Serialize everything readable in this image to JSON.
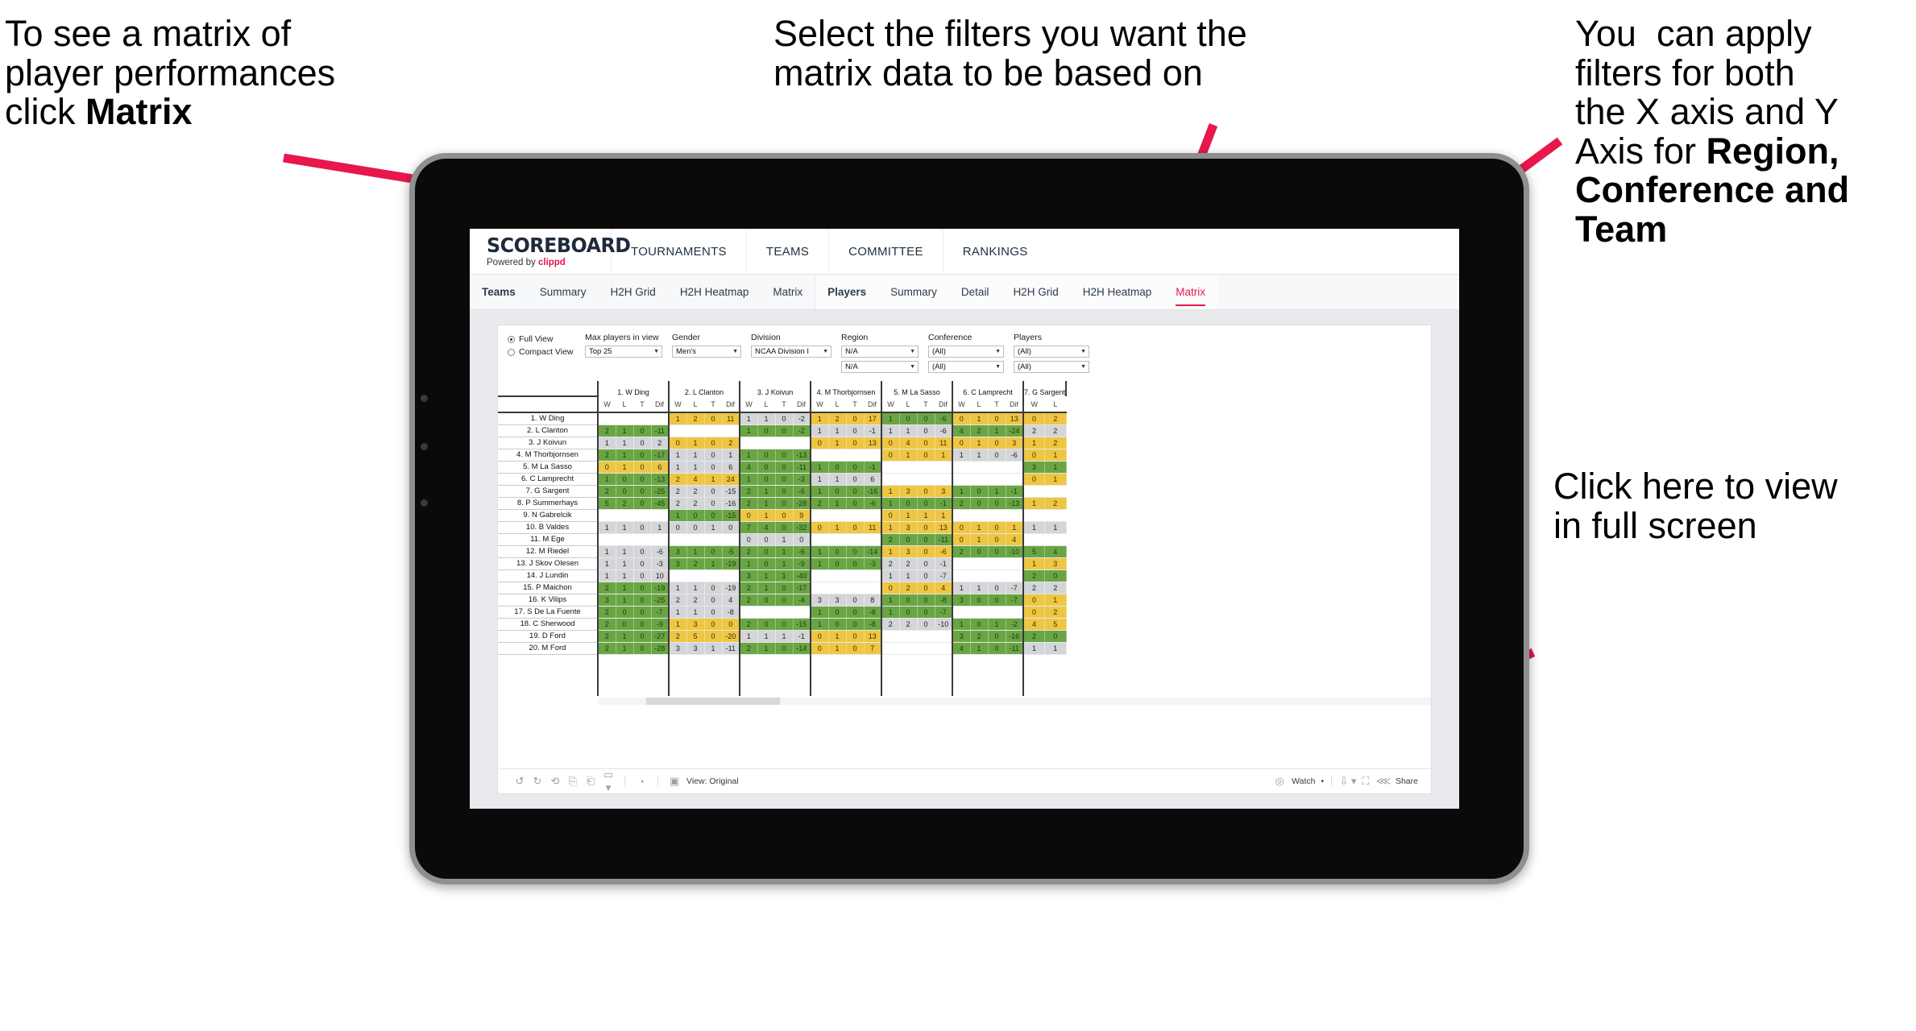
{
  "annotations": {
    "matrix_tip": {
      "pre": "To see a matrix of\nplayer performances\nclick ",
      "strong": "Matrix"
    },
    "filters_tip": {
      "text": "Select the filters you want the\nmatrix data to be based on"
    },
    "axis_tip": {
      "pre": "You  can apply\nfilters for both\nthe X axis and Y\nAxis for ",
      "strong": "Region,\nConference and\nTeam"
    },
    "fullscreen_tip": {
      "text": "Click here to view\nin full screen"
    }
  },
  "brand": {
    "logo": "SCOREBOARD",
    "powered_prefix": "Powered by ",
    "powered_brand": "clippd",
    "accent_color": "#e8174c"
  },
  "topnav": [
    "TOURNAMENTS",
    "TEAMS",
    "COMMITTEE",
    "RANKINGS"
  ],
  "subnav": {
    "teams_group_label": "Teams",
    "teams_items": [
      "Summary",
      "H2H Grid",
      "H2H Heatmap",
      "Matrix"
    ],
    "players_group_label": "Players",
    "players_items": [
      "Summary",
      "Detail",
      "H2H Grid",
      "H2H Heatmap",
      "Matrix"
    ],
    "active": "Matrix"
  },
  "filters": {
    "view_options": [
      "Full View",
      "Compact View"
    ],
    "view_selected": "Full View",
    "controls": [
      {
        "label": "Max players in view",
        "value": "Top 25",
        "row2": null
      },
      {
        "label": "Gender",
        "value": "Men's",
        "row2": null
      },
      {
        "label": "Division",
        "value": "NCAA Division I",
        "row2": null
      },
      {
        "label": "Region",
        "value": "N/A",
        "row2": "N/A"
      },
      {
        "label": "Conference",
        "value": "(All)",
        "row2": "(All)"
      },
      {
        "label": "Players",
        "value": "(All)",
        "row2": "(All)"
      }
    ]
  },
  "chart_data": {
    "type": "heatmap",
    "title": "Player head-to-head performance matrix",
    "stat_headers": [
      "W",
      "L",
      "T",
      "Dif"
    ],
    "columns": [
      "1. W Ding",
      "2. L Clanton",
      "3. J Koivun",
      "4. M Thorbjornsen",
      "5. M La Sasso",
      "6. C Lamprecht",
      "7. G Sargent"
    ],
    "rows": [
      "1. W Ding",
      "2. L Clanton",
      "3. J Koivun",
      "4. M Thorbjornsen",
      "5. M La Sasso",
      "6. C Lamprecht",
      "7. G Sargent",
      "8. P Summerhays",
      "9. N Gabrelcik",
      "10. B Valdes",
      "11. M Ege",
      "12. M Riedel",
      "13. J Skov Olesen",
      "14. J Lundin",
      "15. P Maichon",
      "16. K Vilips",
      "17. S De La Fuente",
      "18. C Sherwood",
      "19. D Ford",
      "20. M Ford"
    ],
    "color_legend": {
      "green": "#6aa544",
      "gray": "#d3d5d8",
      "gold": "#eec643",
      "blank": "#ffffff"
    },
    "cells": [
      [
        {
          "b": 1
        },
        {
          "v": [
            1,
            2,
            0,
            11
          ],
          "c": "gold"
        },
        {
          "v": [
            1,
            1,
            0,
            -2
          ],
          "c": "gray"
        },
        {
          "v": [
            1,
            2,
            0,
            17
          ],
          "c": "gold"
        },
        {
          "v": [
            1,
            0,
            0,
            -6
          ],
          "c": "green"
        },
        {
          "v": [
            0,
            1,
            0,
            13
          ],
          "c": "gold"
        },
        {
          "v": [
            0,
            2
          ],
          "c": "gold"
        }
      ],
      [
        {
          "v": [
            2,
            1,
            0,
            -11
          ],
          "c": "green"
        },
        {
          "b": 1
        },
        {
          "v": [
            1,
            0,
            0,
            -2
          ],
          "c": "green"
        },
        {
          "v": [
            1,
            1,
            0,
            -1
          ],
          "c": "gray"
        },
        {
          "v": [
            1,
            1,
            0,
            -6
          ],
          "c": "gray"
        },
        {
          "v": [
            4,
            2,
            1,
            -24
          ],
          "c": "green"
        },
        {
          "v": [
            2,
            2
          ],
          "c": "gray"
        }
      ],
      [
        {
          "v": [
            1,
            1,
            0,
            2
          ],
          "c": "gray"
        },
        {
          "v": [
            0,
            1,
            0,
            2
          ],
          "c": "gold"
        },
        {
          "b": 1
        },
        {
          "v": [
            0,
            1,
            0,
            13
          ],
          "c": "gold"
        },
        {
          "v": [
            0,
            4,
            0,
            11
          ],
          "c": "gold"
        },
        {
          "v": [
            0,
            1,
            0,
            3
          ],
          "c": "gold"
        },
        {
          "v": [
            1,
            2
          ],
          "c": "gold"
        }
      ],
      [
        {
          "v": [
            2,
            1,
            0,
            -17
          ],
          "c": "green"
        },
        {
          "v": [
            1,
            1,
            0,
            1
          ],
          "c": "gray"
        },
        {
          "v": [
            1,
            0,
            0,
            -13
          ],
          "c": "green"
        },
        {
          "b": 1
        },
        {
          "v": [
            0,
            1,
            0,
            1
          ],
          "c": "gold"
        },
        {
          "v": [
            1,
            1,
            0,
            -6
          ],
          "c": "gray"
        },
        {
          "v": [
            0,
            1
          ],
          "c": "gold"
        }
      ],
      [
        {
          "v": [
            0,
            1,
            0,
            6
          ],
          "c": "gold"
        },
        {
          "v": [
            1,
            1,
            0,
            6
          ],
          "c": "gray"
        },
        {
          "v": [
            4,
            0,
            0,
            -11
          ],
          "c": "green"
        },
        {
          "v": [
            1,
            0,
            0,
            -1
          ],
          "c": "green"
        },
        {
          "b": 1
        },
        {
          "b": 1
        },
        {
          "v": [
            3,
            1
          ],
          "c": "green"
        }
      ],
      [
        {
          "v": [
            1,
            0,
            0,
            -13
          ],
          "c": "green"
        },
        {
          "v": [
            2,
            4,
            1,
            24
          ],
          "c": "gold"
        },
        {
          "v": [
            1,
            0,
            0,
            -3
          ],
          "c": "green"
        },
        {
          "v": [
            1,
            1,
            0,
            6
          ],
          "c": "gray"
        },
        {
          "b": 1
        },
        {
          "b": 1
        },
        {
          "v": [
            0,
            1
          ],
          "c": "gold"
        }
      ],
      [
        {
          "v": [
            2,
            0,
            0,
            -25
          ],
          "c": "green"
        },
        {
          "v": [
            2,
            2,
            0,
            -15
          ],
          "c": "gray"
        },
        {
          "v": [
            2,
            1,
            0,
            -6
          ],
          "c": "green"
        },
        {
          "v": [
            1,
            0,
            0,
            -16
          ],
          "c": "green"
        },
        {
          "v": [
            1,
            3,
            0,
            3
          ],
          "c": "gold"
        },
        {
          "v": [
            1,
            0,
            1,
            -1
          ],
          "c": "green"
        },
        {
          "b": 1
        }
      ],
      [
        {
          "v": [
            5,
            2,
            0,
            -45
          ],
          "c": "green"
        },
        {
          "v": [
            2,
            2,
            0,
            -16
          ],
          "c": "gray"
        },
        {
          "v": [
            2,
            1,
            0,
            -28
          ],
          "c": "green"
        },
        {
          "v": [
            2,
            1,
            0,
            -6
          ],
          "c": "green"
        },
        {
          "v": [
            1,
            0,
            0,
            -1
          ],
          "c": "green"
        },
        {
          "v": [
            2,
            0,
            0,
            -13
          ],
          "c": "green"
        },
        {
          "v": [
            1,
            2
          ],
          "c": "gold"
        }
      ],
      [
        {
          "b": 1
        },
        {
          "v": [
            1,
            0,
            0,
            -15
          ],
          "c": "green"
        },
        {
          "v": [
            0,
            1,
            0,
            9
          ],
          "c": "gold"
        },
        {
          "b": 1
        },
        {
          "v": [
            0,
            1,
            1,
            1
          ],
          "c": "gold"
        },
        {
          "b": 1
        },
        {
          "b": 1
        }
      ],
      [
        {
          "v": [
            1,
            1,
            0,
            1
          ],
          "c": "gray"
        },
        {
          "v": [
            0,
            0,
            1,
            0
          ],
          "c": "gray"
        },
        {
          "v": [
            7,
            4,
            0,
            -32
          ],
          "c": "green"
        },
        {
          "v": [
            0,
            1,
            0,
            11
          ],
          "c": "gold"
        },
        {
          "v": [
            1,
            3,
            0,
            13
          ],
          "c": "gold"
        },
        {
          "v": [
            0,
            1,
            0,
            1
          ],
          "c": "gold"
        },
        {
          "v": [
            1,
            1
          ],
          "c": "gray"
        }
      ],
      [
        {
          "b": 1
        },
        {
          "b": 1
        },
        {
          "v": [
            0,
            0,
            1,
            0
          ],
          "c": "gray"
        },
        {
          "b": 1
        },
        {
          "v": [
            2,
            0,
            0,
            -11
          ],
          "c": "green"
        },
        {
          "v": [
            0,
            1,
            0,
            4
          ],
          "c": "gold"
        },
        {
          "b": 1
        }
      ],
      [
        {
          "v": [
            1,
            1,
            0,
            -6
          ],
          "c": "gray"
        },
        {
          "v": [
            3,
            1,
            0,
            -5
          ],
          "c": "green"
        },
        {
          "v": [
            2,
            0,
            1,
            -6
          ],
          "c": "green"
        },
        {
          "v": [
            1,
            0,
            0,
            -14
          ],
          "c": "green"
        },
        {
          "v": [
            1,
            3,
            0,
            -6
          ],
          "c": "gold"
        },
        {
          "v": [
            2,
            0,
            0,
            -10
          ],
          "c": "green"
        },
        {
          "v": [
            5,
            4
          ],
          "c": "green"
        }
      ],
      [
        {
          "v": [
            1,
            1,
            0,
            -3
          ],
          "c": "gray"
        },
        {
          "v": [
            3,
            2,
            1,
            -19
          ],
          "c": "green"
        },
        {
          "v": [
            1,
            0,
            1,
            -9
          ],
          "c": "green"
        },
        {
          "v": [
            1,
            0,
            0,
            -3
          ],
          "c": "green"
        },
        {
          "v": [
            2,
            2,
            0,
            -1
          ],
          "c": "gray"
        },
        {
          "b": 1
        },
        {
          "v": [
            1,
            3
          ],
          "c": "gold"
        }
      ],
      [
        {
          "v": [
            1,
            1,
            0,
            10
          ],
          "c": "gray"
        },
        {
          "b": 1
        },
        {
          "v": [
            3,
            1,
            1,
            -40
          ],
          "c": "green"
        },
        {
          "b": 1
        },
        {
          "v": [
            1,
            1,
            0,
            -7
          ],
          "c": "gray"
        },
        {
          "b": 1
        },
        {
          "v": [
            2,
            0
          ],
          "c": "green"
        }
      ],
      [
        {
          "v": [
            2,
            1,
            0,
            -19
          ],
          "c": "green"
        },
        {
          "v": [
            1,
            1,
            0,
            -19
          ],
          "c": "gray"
        },
        {
          "v": [
            2,
            1,
            0,
            -17
          ],
          "c": "green"
        },
        {
          "b": 1
        },
        {
          "v": [
            0,
            2,
            0,
            4
          ],
          "c": "gold"
        },
        {
          "v": [
            1,
            1,
            0,
            -7
          ],
          "c": "gray"
        },
        {
          "v": [
            2,
            2
          ],
          "c": "gray"
        }
      ],
      [
        {
          "v": [
            3,
            1,
            0,
            -25
          ],
          "c": "green"
        },
        {
          "v": [
            2,
            2,
            0,
            4
          ],
          "c": "gray"
        },
        {
          "v": [
            2,
            0,
            0,
            -4
          ],
          "c": "green"
        },
        {
          "v": [
            3,
            3,
            0,
            8
          ],
          "c": "gray"
        },
        {
          "v": [
            1,
            0,
            0,
            -8
          ],
          "c": "green"
        },
        {
          "v": [
            3,
            0,
            0,
            -7
          ],
          "c": "green"
        },
        {
          "v": [
            0,
            1
          ],
          "c": "gold"
        }
      ],
      [
        {
          "v": [
            2,
            0,
            0,
            -7
          ],
          "c": "green"
        },
        {
          "v": [
            1,
            1,
            0,
            -8
          ],
          "c": "gray"
        },
        {
          "b": 1
        },
        {
          "v": [
            1,
            0,
            0,
            -8
          ],
          "c": "green"
        },
        {
          "v": [
            1,
            0,
            0,
            -7
          ],
          "c": "green"
        },
        {
          "b": 1
        },
        {
          "v": [
            0,
            2
          ],
          "c": "gold"
        }
      ],
      [
        {
          "v": [
            2,
            0,
            0,
            -9
          ],
          "c": "green"
        },
        {
          "v": [
            1,
            3,
            0,
            0
          ],
          "c": "gold"
        },
        {
          "v": [
            2,
            0,
            0,
            -15
          ],
          "c": "green"
        },
        {
          "v": [
            1,
            0,
            0,
            -8
          ],
          "c": "green"
        },
        {
          "v": [
            2,
            2,
            0,
            -10
          ],
          "c": "gray"
        },
        {
          "v": [
            1,
            0,
            1,
            -2
          ],
          "c": "green"
        },
        {
          "v": [
            4,
            5
          ],
          "c": "gold"
        }
      ],
      [
        {
          "v": [
            2,
            1,
            0,
            -27
          ],
          "c": "green"
        },
        {
          "v": [
            2,
            5,
            0,
            -20
          ],
          "c": "gold"
        },
        {
          "v": [
            1,
            1,
            1,
            -1
          ],
          "c": "gray"
        },
        {
          "v": [
            0,
            1,
            0,
            13
          ],
          "c": "gold"
        },
        {
          "b": 1
        },
        {
          "v": [
            3,
            2,
            0,
            -16
          ],
          "c": "green"
        },
        {
          "v": [
            2,
            0
          ],
          "c": "green"
        }
      ],
      [
        {
          "v": [
            2,
            1,
            0,
            -28
          ],
          "c": "green"
        },
        {
          "v": [
            3,
            3,
            1,
            -11
          ],
          "c": "gray"
        },
        {
          "v": [
            2,
            1,
            0,
            -14
          ],
          "c": "green"
        },
        {
          "v": [
            0,
            1,
            0,
            7
          ],
          "c": "gold"
        },
        {
          "b": 1
        },
        {
          "v": [
            4,
            1,
            0,
            -11
          ],
          "c": "green"
        },
        {
          "v": [
            1,
            1
          ],
          "c": "gray"
        }
      ]
    ]
  },
  "bottombar": {
    "icons": [
      "undo-icon",
      "redo-icon",
      "revert-icon",
      "refresh-data-icon",
      "pause-updates-icon",
      "device-layout-icon"
    ],
    "view_label": "View: Original",
    "watch_label": "Watch",
    "share_label": "Share",
    "fullscreen_icon": "fullscreen-icon",
    "download_icon": "download-icon"
  }
}
